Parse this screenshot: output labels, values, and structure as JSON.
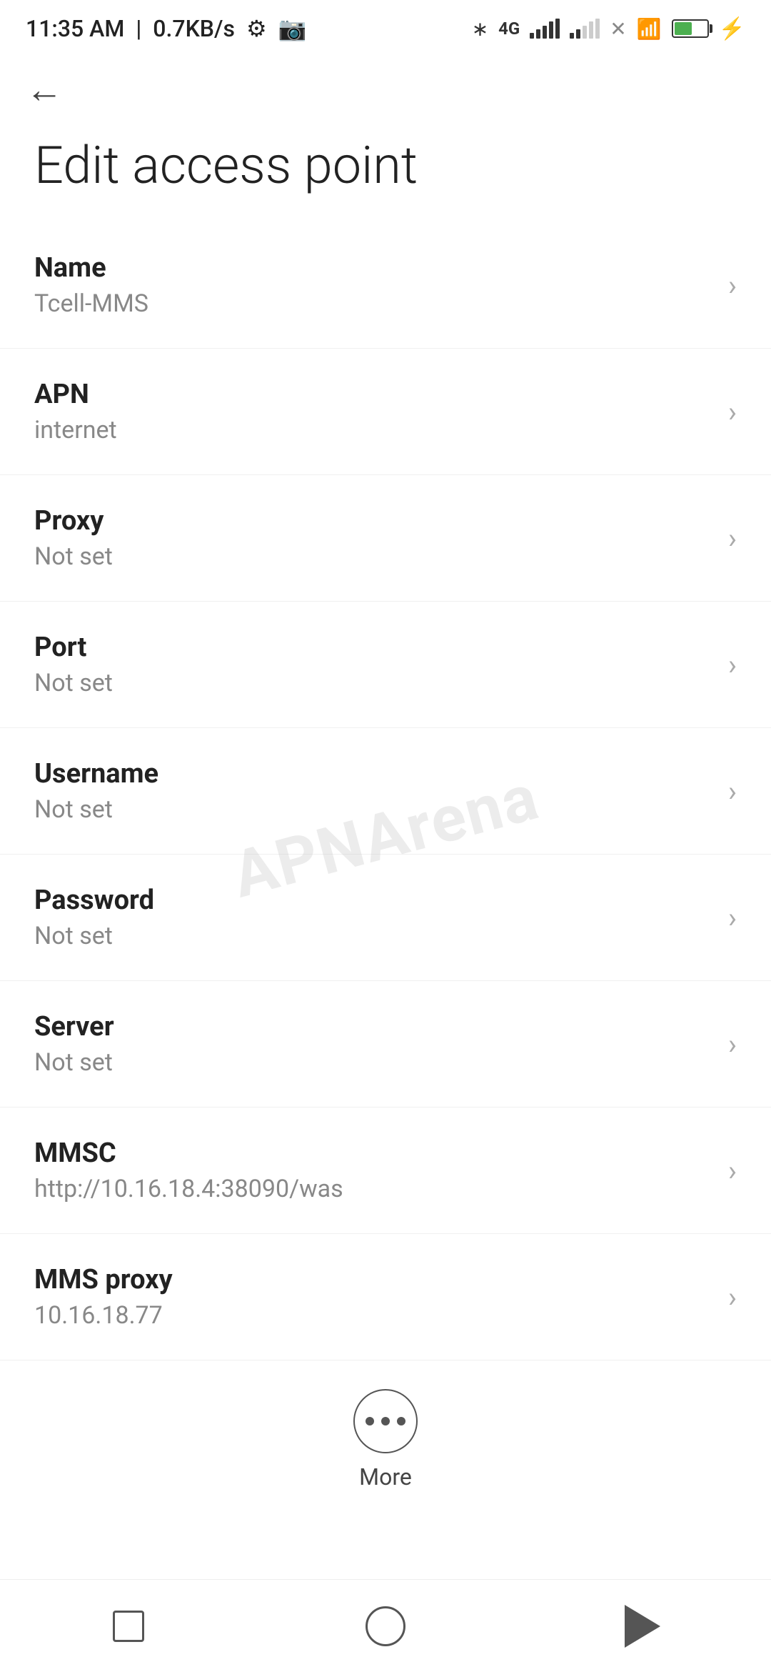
{
  "statusBar": {
    "time": "11:35 AM",
    "speed": "0.7KB/s",
    "batteryLevel": 38
  },
  "header": {
    "backLabel": "←",
    "title": "Edit access point"
  },
  "settingsItems": [
    {
      "id": "name",
      "label": "Name",
      "value": "Tcell-MMS"
    },
    {
      "id": "apn",
      "label": "APN",
      "value": "internet"
    },
    {
      "id": "proxy",
      "label": "Proxy",
      "value": "Not set"
    },
    {
      "id": "port",
      "label": "Port",
      "value": "Not set"
    },
    {
      "id": "username",
      "label": "Username",
      "value": "Not set"
    },
    {
      "id": "password",
      "label": "Password",
      "value": "Not set"
    },
    {
      "id": "server",
      "label": "Server",
      "value": "Not set"
    },
    {
      "id": "mmsc",
      "label": "MMSC",
      "value": "http://10.16.18.4:38090/was"
    },
    {
      "id": "mms-proxy",
      "label": "MMS proxy",
      "value": "10.16.18.77"
    }
  ],
  "more": {
    "label": "More"
  },
  "watermark": "APNArena"
}
